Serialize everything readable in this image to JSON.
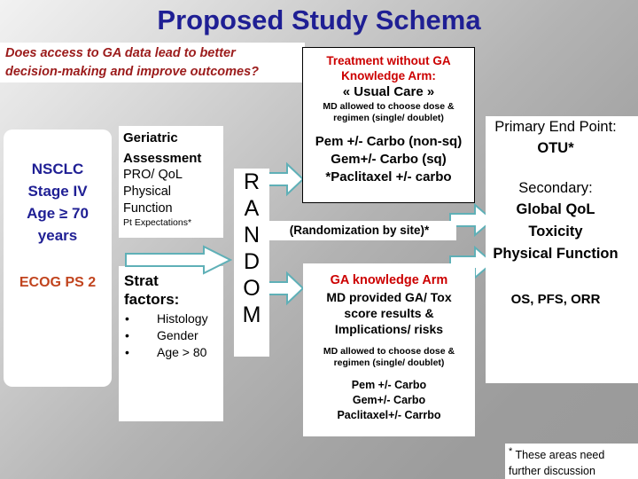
{
  "title": "Proposed Study Schema",
  "question": {
    "line1": "Does access to GA data lead to better",
    "line2": "decision-making and improve outcomes?"
  },
  "eligibility": {
    "line1": "NSCLC",
    "line2": "Stage IV",
    "line3": "Age  ≥ 70",
    "line4": "years",
    "ecog": "ECOG PS 2"
  },
  "geriatric_assessment": {
    "head1": "Geriatric",
    "head2": "Assessment",
    "item1": "PRO/ QoL",
    "item2": "Physical",
    "item3": "Function",
    "item4": "Pt Expectations*"
  },
  "strat": {
    "head1": "Strat",
    "head2": "factors:",
    "bullet": "•",
    "items": [
      "Histology",
      "Gender",
      "Age > 80"
    ]
  },
  "randomization": {
    "letters": [
      "R",
      "A",
      "N",
      "D",
      "O",
      "M"
    ],
    "caption": "(Randomization by site)*"
  },
  "usual_care_arm": {
    "title_l1": "Treatment without GA",
    "title_l2": "Knowledge Arm:",
    "subtitle": "« Usual Care »",
    "note_l1": "MD allowed to choose dose  &",
    "note_l2": "regimen  (single/ doublet)",
    "reg1": "Pem +/- Carbo (non-sq)",
    "reg2": "Gem+/- Carbo (sq)",
    "reg3": "*Paclitaxel +/- carbo"
  },
  "ga_arm": {
    "title": "GA knowledge Arm",
    "desc_l1": "MD provided GA/ Tox",
    "desc_l2": "score results &",
    "desc_l3": "Implications/ risks",
    "note_l1": "MD allowed to choose dose  &",
    "note_l2": "regimen  (single/ doublet)",
    "reg1": "Pem +/- Carbo",
    "reg2": "Gem+/- Carbo",
    "reg3": "Paclitaxel+/- Carrbo"
  },
  "endpoints": {
    "primary_label": "Primary End Point:",
    "primary_value": "OTU*",
    "secondary_label": "Secondary:",
    "secondary_1": "Global QoL",
    "secondary_2": "Toxicity",
    "secondary_3": "Physical Function",
    "secondary_4": "OS, PFS, ORR"
  },
  "footnote": {
    "star": "*",
    "line1": "These areas need",
    "line2": "further discussion"
  },
  "colors": {
    "title_blue": "#1f1f94",
    "question_dark_red": "#9b1b1b",
    "arm_red": "#cc0000",
    "ecog_orange": "#c1441e",
    "arrow_outline": "#5fb0b7",
    "arrow_fill": "#ffffff"
  }
}
